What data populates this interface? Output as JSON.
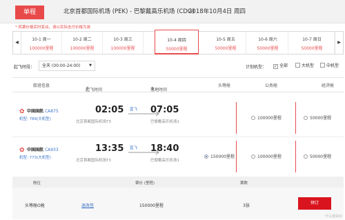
{
  "header": {
    "trip_type": "单程",
    "route": "北京首都国际机场 (PEK) - 巴黎戴高乐机场 (CDG)",
    "date": "2018年10月4日 周四"
  },
  "notice": "* 机票价格实时变动，请以实际支付价格为准",
  "date_strip": {
    "prev": "◀",
    "next": "▶",
    "dates": [
      {
        "date": "10-1 周一",
        "price": "100000里程"
      },
      {
        "date": "10-2 周二",
        "price": "100000里程"
      },
      {
        "date": "10-3 周三",
        "price": "100000里程"
      },
      {
        "date": "10-4 周四",
        "price": "50000里程"
      },
      {
        "date": "10-5 周五",
        "price": "50000里程"
      },
      {
        "date": "10-6 周六",
        "price": "50000里程"
      },
      {
        "date": "10-7 周日",
        "price": "50000里程"
      }
    ],
    "active_index": 3
  },
  "filters": {
    "time_label": "起飞时段：",
    "time_value": "全天 (00:00-24:00)",
    "time_caret": "▼",
    "type_label": "计划机型：",
    "types": [
      {
        "label": "全部",
        "checked": true
      },
      {
        "label": "大机型",
        "checked": false
      },
      {
        "label": "中机型",
        "checked": false
      }
    ]
  },
  "columns": {
    "flight_info": "航班信息",
    "dep_time": "起飞时间",
    "arr_time": "落地时间",
    "first": "头等舱",
    "business": "公务舱",
    "economy": "经济舱",
    "sort_icon": "⇕"
  },
  "flights": [
    {
      "airline": "中国国航",
      "flight_no": "CA875",
      "aircraft": "机型: 789(大机型)",
      "dep_time": "02:05",
      "dep_airport": "北京首都国际机场T3",
      "direct": "直飞",
      "arr_time": "07:05",
      "arr_airport": "巴黎戴高乐机场1",
      "first": "",
      "business": "100000里程",
      "economy": "50000里程"
    },
    {
      "airline": "中国国航",
      "flight_no": "CA933",
      "aircraft": "机型: 773(大机型)",
      "dep_time": "13:35",
      "dep_airport": "北京首都国际机场T3",
      "direct": "直飞",
      "arr_time": "18:40",
      "arr_airport": "巴黎戴高乐机场1",
      "first": "150000里程",
      "business": "100000里程",
      "economy": "50000里程"
    }
  ],
  "cabin_table": {
    "headers": {
      "cabin": "舱位",
      "price": "票价 (里程)",
      "seats": "票数"
    },
    "row": {
      "cabin": "头等舱O舱",
      "rule": "退改签",
      "price": "150000里程",
      "seats": "3张",
      "book": "预订"
    }
  },
  "watermark": "什么值得买",
  "colors": {
    "accent": "#e84a4a",
    "link": "#3b73c8",
    "book": "#d9141e"
  }
}
